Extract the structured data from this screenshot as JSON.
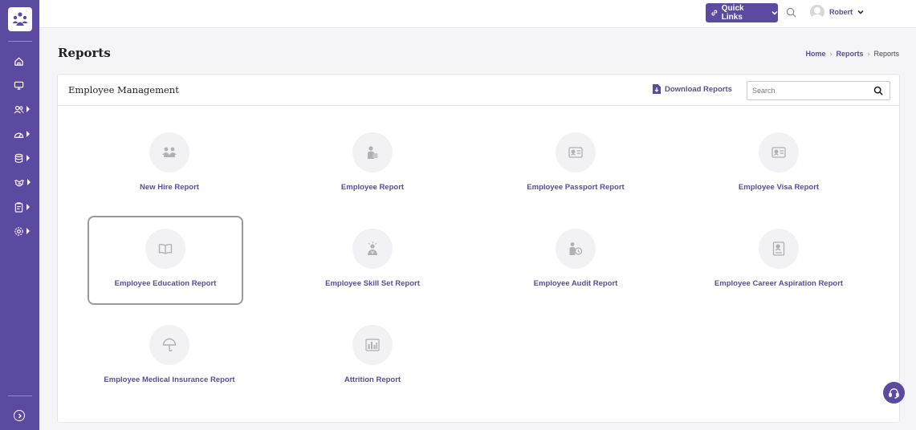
{
  "colors": {
    "brand": "#5b4aa0",
    "icon_gray": "#b0b0b5",
    "tile_bg": "#f2f2f4"
  },
  "sidebar": {
    "items": [
      {
        "icon": "home-icon"
      },
      {
        "icon": "monitor-icon"
      },
      {
        "icon": "users-icon",
        "expandable": true
      },
      {
        "icon": "dashboard-icon",
        "expandable": true
      },
      {
        "icon": "database-icon",
        "expandable": true
      },
      {
        "icon": "handshake-icon",
        "expandable": true
      },
      {
        "icon": "clipboard-icon",
        "expandable": true
      },
      {
        "icon": "settings-icon",
        "expandable": true
      }
    ],
    "footer_icon": "expand-sidebar-icon"
  },
  "topbar": {
    "quick_links_label": "Quick Links",
    "user_name": "Robert"
  },
  "page": {
    "title": "Reports",
    "breadcrumb": [
      "Home",
      "Reports",
      "Reports"
    ]
  },
  "card": {
    "title": "Employee Management",
    "download_label": "Download Reports",
    "search_placeholder": "Search"
  },
  "reports": [
    {
      "label": "New Hire Report",
      "icon": "team-icon"
    },
    {
      "label": "Employee Report",
      "icon": "person-badge-icon"
    },
    {
      "label": "Employee Passport Report",
      "icon": "id-card-icon"
    },
    {
      "label": "Employee Visa Report",
      "icon": "visa-card-icon"
    },
    {
      "label": "Employee Education Report",
      "icon": "book-icon",
      "selected": true
    },
    {
      "label": "Employee Skill Set Report",
      "icon": "skill-person-icon"
    },
    {
      "label": "Employee Audit Report",
      "icon": "audit-person-icon"
    },
    {
      "label": "Employee Career Aspiration Report",
      "icon": "career-document-icon"
    },
    {
      "label": "Employee Medical Insurance Report",
      "icon": "umbrella-icon"
    },
    {
      "label": "Attrition Report",
      "icon": "bar-chart-icon"
    }
  ]
}
